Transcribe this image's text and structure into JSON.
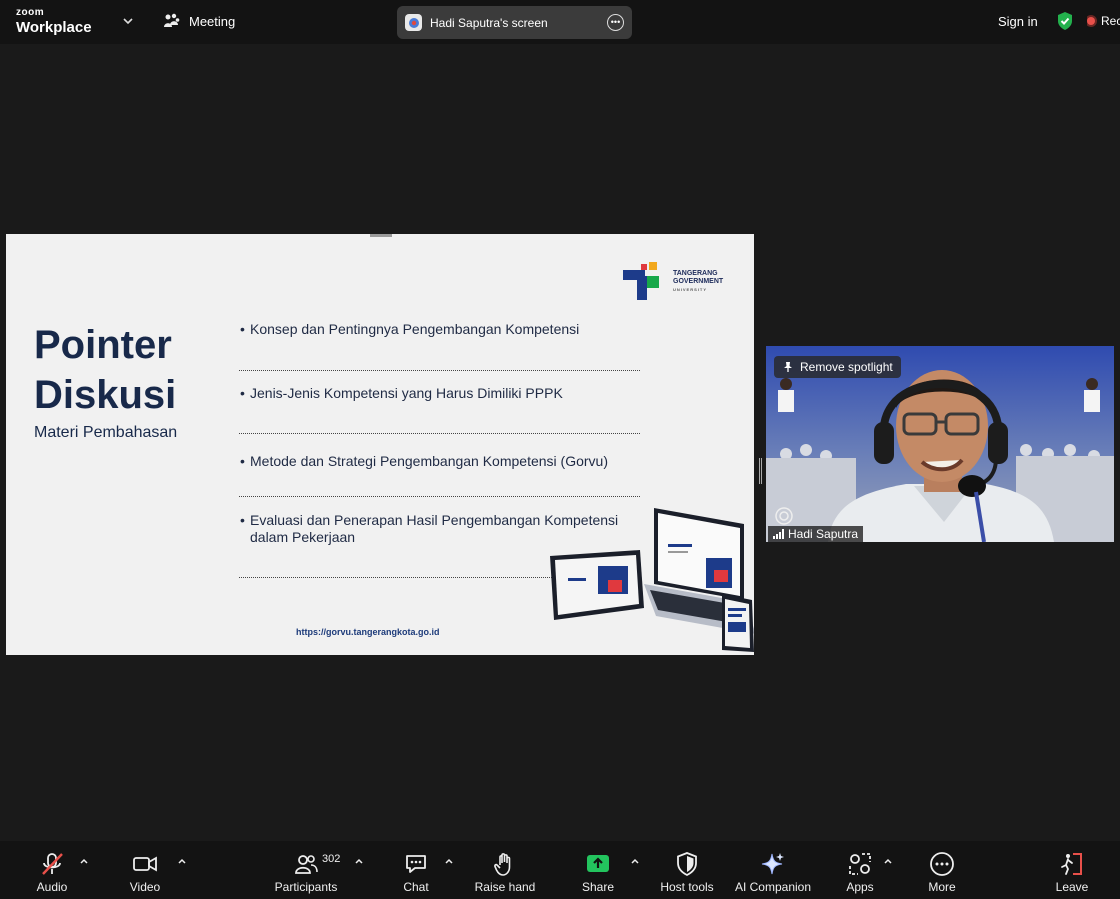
{
  "app": {
    "logo_top": "zoom",
    "logo_bottom": "Workplace"
  },
  "header": {
    "meeting_label": "Meeting",
    "screen_share_label": "Hadi Saputra's screen",
    "sign_in": "Sign in",
    "recording_label": "Rec"
  },
  "slide": {
    "title_line1": "Pointer",
    "title_line2": "Diskusi",
    "subtitle": "Materi Pembahasan",
    "logo_line1": "TANGERANG",
    "logo_line2": "GOVERNMENT",
    "logo_line3": "UNIVERSITY",
    "bullets": [
      "Konsep dan Pentingnya Pengembangan Kompetensi",
      "Jenis-Jenis Kompetensi yang Harus Dimiliki PPPK",
      "Metode dan Strategi Pengembangan Kompetensi (Gorvu)",
      "Evaluasi dan Penerapan Hasil Pengembangan Kompetensi dalam Pekerjaan"
    ],
    "url": "https://gorvu.tangerangkota.go.id"
  },
  "video": {
    "spotlight_label": "Remove spotlight",
    "participant_name": "Hadi Saputra"
  },
  "toolbar": {
    "audio": "Audio",
    "video": "Video",
    "participants": "Participants",
    "participants_count": "302",
    "chat": "Chat",
    "raise_hand": "Raise hand",
    "share": "Share",
    "host_tools": "Host tools",
    "ai_companion": "AI Companion",
    "apps": "Apps",
    "more": "More",
    "leave": "Leave"
  },
  "colors": {
    "share_green": "#23c45e",
    "leave_red": "#e8504a",
    "shield_green": "#23b14d",
    "slide_title": "#18294a"
  }
}
